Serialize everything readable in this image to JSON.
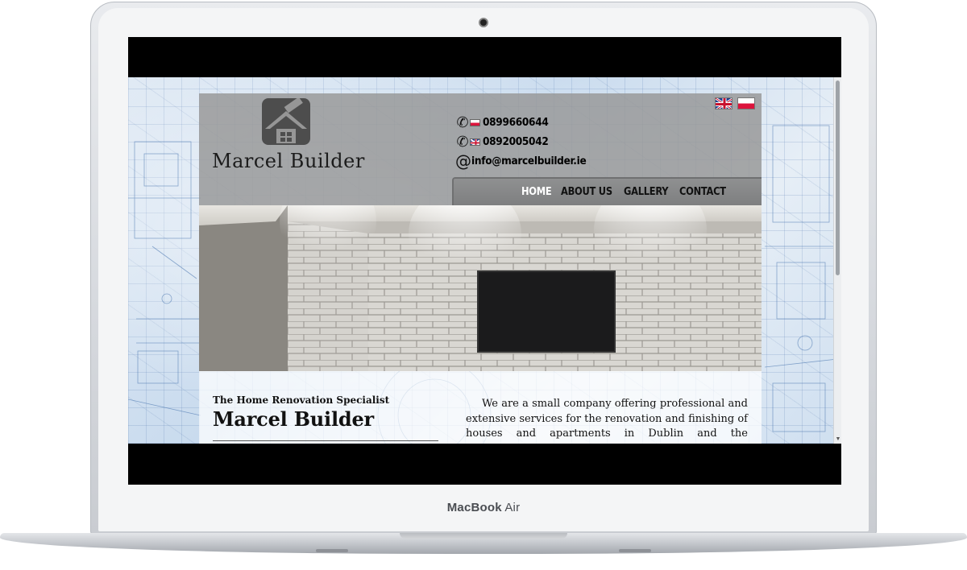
{
  "device": {
    "brand_name": "MacBook",
    "brand_model": "Air"
  },
  "site": {
    "logo": {
      "text": "Marcel Builder",
      "icon": "house-hammer-icon"
    },
    "languages": [
      {
        "code": "en",
        "icon": "uk-flag-icon"
      },
      {
        "code": "pl",
        "icon": "poland-flag-icon"
      }
    ],
    "contact": {
      "phone_pl": "0899660644",
      "phone_uk": "0892005042",
      "email": "info@marcelbuilder.ie"
    },
    "nav": {
      "items": [
        "HOME",
        "ABOUT US",
        "GALLERY",
        "CONTACT"
      ],
      "active": "HOME"
    },
    "main": {
      "tagline": "The Home Renovation Specialist",
      "heading": "Marcel Builder",
      "intro": "We are a small company offering professional and extensive services for the renovation and finishing of houses and apartments in Dublin and the surrounding"
    }
  },
  "colors": {
    "header_bg": "#969696",
    "nav_bg": "#878889",
    "nav_active": "#ffffff",
    "text": "#111111",
    "flag_pl_red": "#dc143c",
    "flag_uk_blue": "#1f3d8c"
  }
}
